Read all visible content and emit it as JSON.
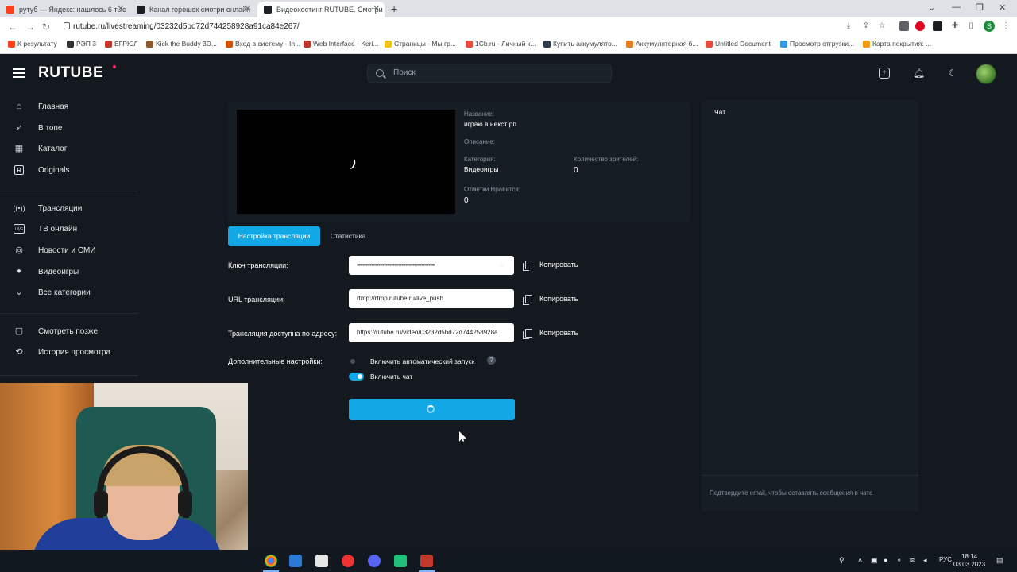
{
  "browser": {
    "tabs": [
      {
        "title": "рутуб — Яндекс: нашлось 6 тыс",
        "active": false,
        "favicon_color": "#fc3f1d"
      },
      {
        "title": "Канал горошек смотри онлайн",
        "active": false,
        "favicon_color": "#1b1f23"
      },
      {
        "title": "Видеохостинг RUTUBE. Смотри",
        "active": true,
        "favicon_color": "#1b1f23"
      }
    ],
    "new_tab": "+",
    "url": "rutube.ru/livestreaming/03232d5bd72d744258928a91ca84e267/",
    "bookmarks": [
      {
        "label": "К результату",
        "color": "#fc3f1d"
      },
      {
        "label": "РЭП 3",
        "color": "#333333"
      },
      {
        "label": "ЕГРЮЛ",
        "color": "#c0392b"
      },
      {
        "label": "Kick the Buddy 3D...",
        "color": "#8e5a2b"
      },
      {
        "label": "Вход в систему - In...",
        "color": "#d35400"
      },
      {
        "label": "Web Interface - Keri...",
        "color": "#c0392b"
      },
      {
        "label": "Страницы - Мы гр...",
        "color": "#f1c40f"
      },
      {
        "label": "1Сb.ru - Личный к...",
        "color": "#e74c3c"
      },
      {
        "label": "Купить аккумулято...",
        "color": "#2c3e50"
      },
      {
        "label": "Аккумуляторная б...",
        "color": "#e67e22"
      },
      {
        "label": "Untitled Document",
        "color": "#e74c3c"
      },
      {
        "label": "Просмотр отгрузки...",
        "color": "#3498db"
      },
      {
        "label": "Карта покрытия: ...",
        "color": "#f39c12"
      }
    ],
    "profile_letter": "S"
  },
  "header": {
    "logo": "RUTUBE",
    "search_placeholder": "Поиск",
    "icons": [
      "upload-icon",
      "bell-icon",
      "moon-icon"
    ]
  },
  "sidebar": {
    "items": [
      {
        "label": "Главная",
        "icon": "⌂"
      },
      {
        "label": "В топе",
        "icon": "✈"
      },
      {
        "label": "Каталог",
        "icon": "▦"
      },
      {
        "label": "Originals",
        "icon": "R"
      },
      {
        "label": "Трансляции",
        "icon": "((•))"
      },
      {
        "label": "ТВ онлайн",
        "icon": "LIVE"
      },
      {
        "label": "Новости и СМИ",
        "icon": "◎"
      },
      {
        "label": "Видеоигры",
        "icon": "✦"
      },
      {
        "label": "Все категории",
        "icon": "⌄"
      },
      {
        "label": "Смотреть позже",
        "icon": "▢"
      },
      {
        "label": "История просмотра",
        "icon": "⟲"
      }
    ]
  },
  "stream_info": {
    "title_label": "Название:",
    "title_value": "играю в некст рп",
    "description_label": "Описание:",
    "category_label": "Категория:",
    "category_value": "Видеоигры",
    "viewers_label": "Количество зрителей:",
    "viewers_value": "0",
    "likes_label": "Отметки Нравится:",
    "likes_value": "0"
  },
  "tabs": [
    {
      "label": "Настройка трансляции",
      "active": true
    },
    {
      "label": "Статистика",
      "active": false
    }
  ],
  "settings": {
    "key_label": "Ключ трансляции:",
    "key_value": "••••••••••••••••••••••••••••••••••••••••••••••••••••••",
    "url_label": "URL трансляции:",
    "url_value": "rtmp://rtmp.rutube.ru/live_push",
    "address_label": "Трансляция доступна по адресу:",
    "address_value": "https://rutube.ru/video/03232d5bd72d744258928a",
    "copy_label": "Копировать",
    "extra_label": "Дополнительные настройки:",
    "autostart_label": "Включить автоматический запуск",
    "autostart_on": false,
    "chat_toggle_label": "Включить чат",
    "chat_on": true,
    "help": "?"
  },
  "chat": {
    "title": "Чат",
    "note": "Подтвердите email, чтобы оставлять сообщения в чате"
  },
  "taskbar": {
    "lang": "РУС",
    "time": "18:14",
    "date": "03.03.2023"
  }
}
